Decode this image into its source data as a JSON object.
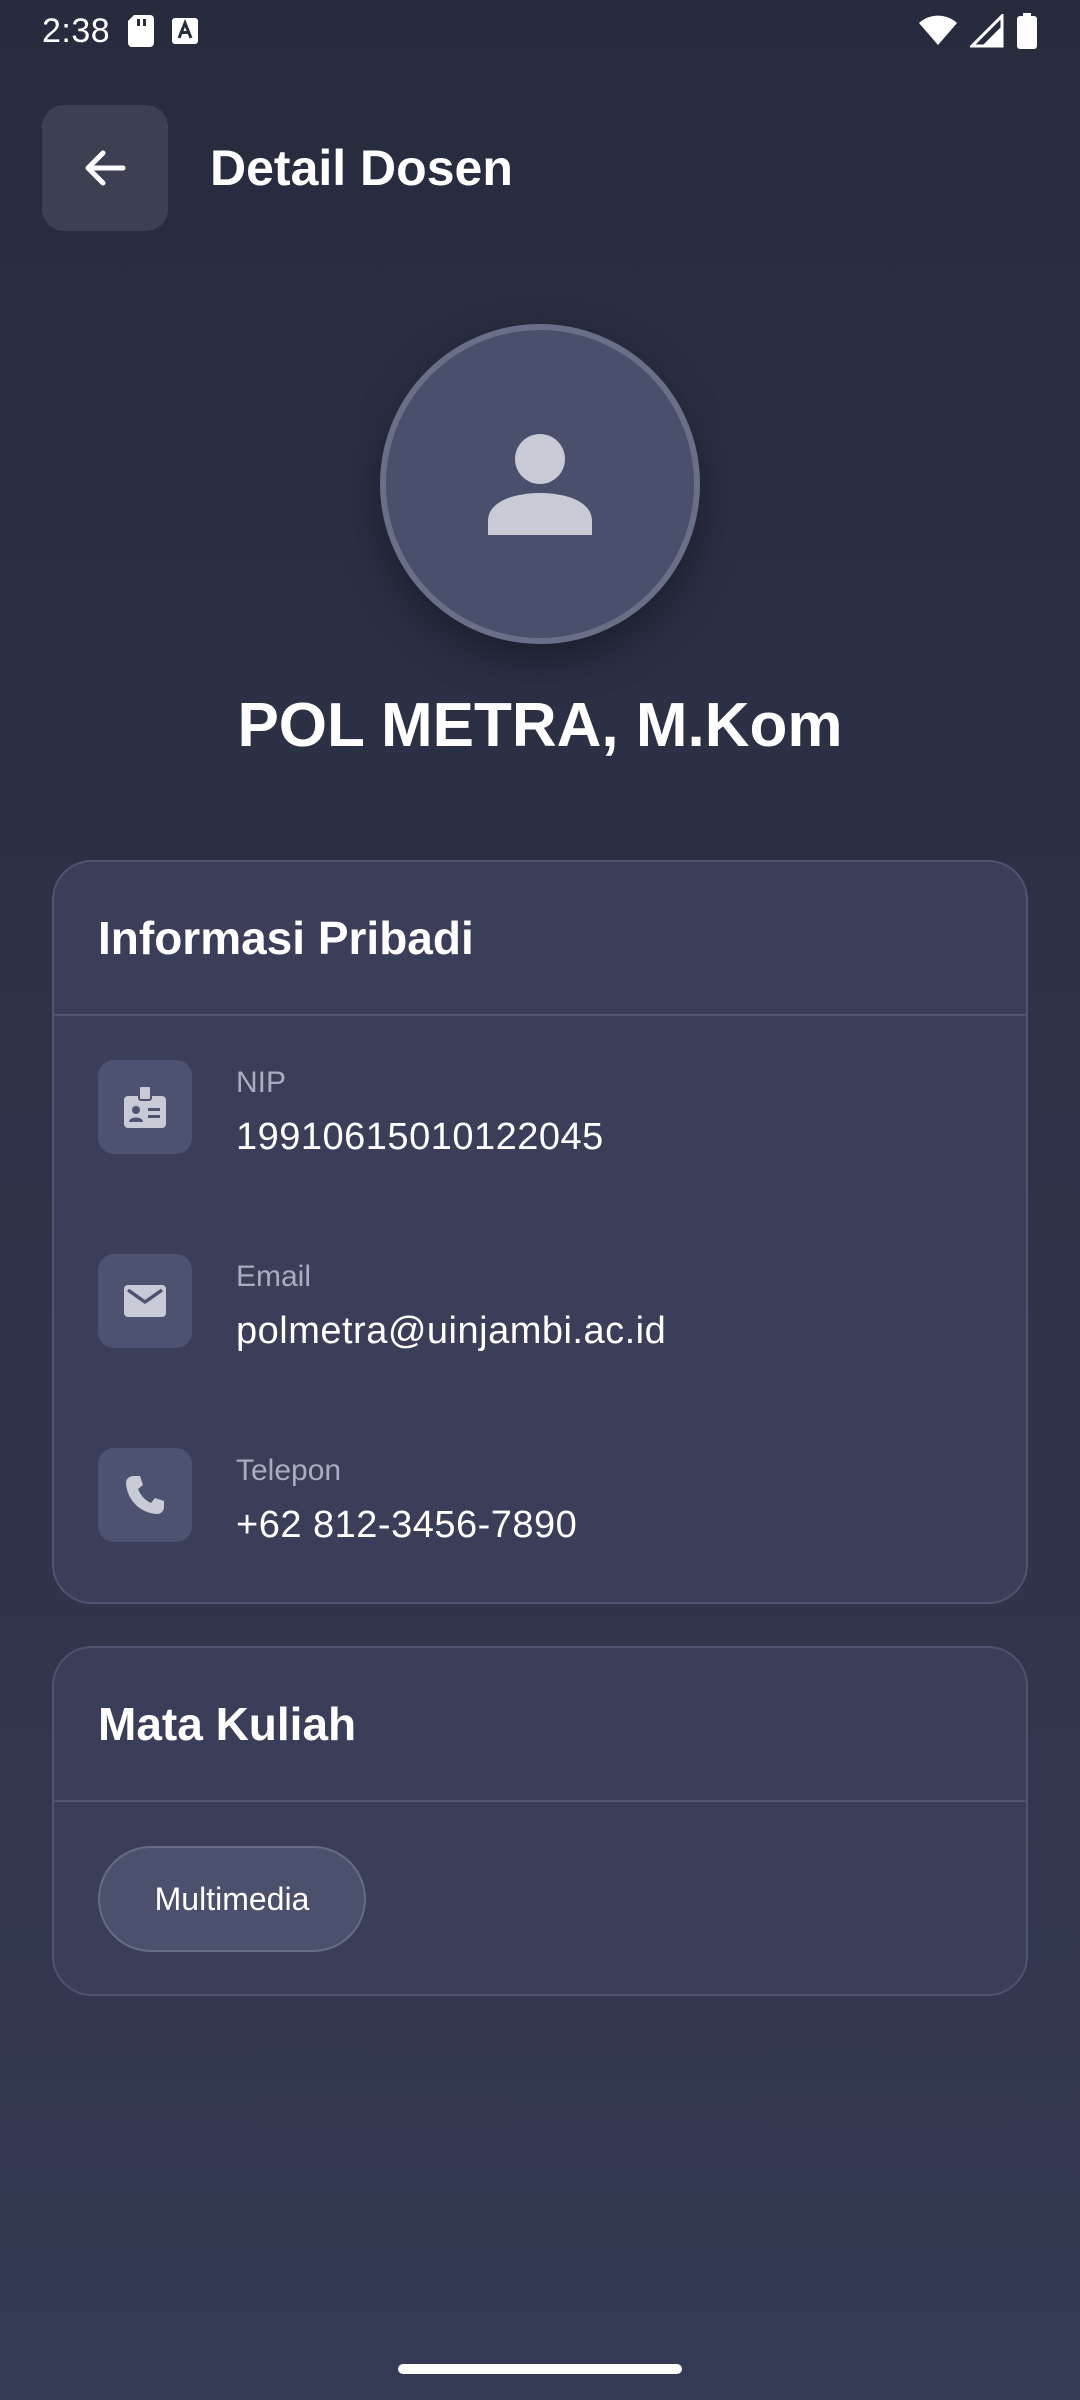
{
  "status_bar": {
    "time": "2:38",
    "icons": [
      "sd-card-icon",
      "a-notification-icon",
      "wifi-icon",
      "signal-icon",
      "battery-icon"
    ]
  },
  "app_bar": {
    "back_icon": "arrow-left-icon",
    "title": "Detail Dosen"
  },
  "profile": {
    "avatar_icon": "person-icon",
    "name": "POL METRA, M.Kom"
  },
  "info_card": {
    "title": "Informasi Pribadi",
    "items": [
      {
        "icon": "id-badge-icon",
        "label": "NIP",
        "value": "199106150101220​45"
      },
      {
        "icon": "mail-icon",
        "label": "Email",
        "value": "polmetra@uinjambi.ac.id"
      },
      {
        "icon": "phone-icon",
        "label": "Telepon",
        "value": "+62 812-3456-7890"
      }
    ]
  },
  "courses_card": {
    "title": "Mata Kuliah",
    "chips": [
      "Multimedia"
    ]
  },
  "colors": {
    "background": "#2c3045",
    "card": "#3a3e58",
    "icon_box": "#4c5270",
    "text_muted": "#a9adbf"
  }
}
